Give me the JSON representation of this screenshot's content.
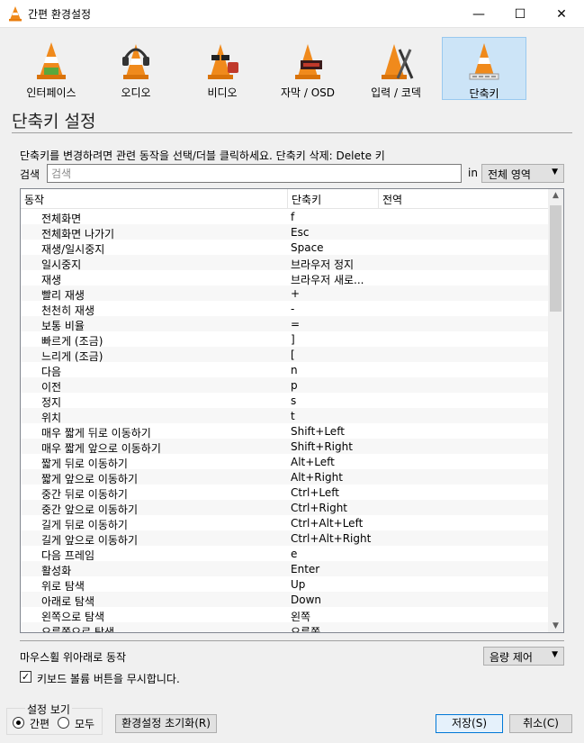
{
  "window": {
    "title": "간편 환경설정",
    "minimize": "—",
    "maximize": "☐",
    "close": "✕"
  },
  "categories": [
    {
      "label": "인터페이스",
      "icon": "interface-cone-icon"
    },
    {
      "label": "오디오",
      "icon": "audio-headphones-icon"
    },
    {
      "label": "비디오",
      "icon": "video-glasses-icon"
    },
    {
      "label": "자막 / OSD",
      "icon": "subtitle-osd-icon"
    },
    {
      "label": "입력 / 코덱",
      "icon": "input-codec-icon"
    },
    {
      "label": "단축키",
      "icon": "hotkeys-icon",
      "selected": true
    }
  ],
  "section_title": "단축키 설정",
  "hint": "단축키를 변경하려면 관련 동작을 선택/더블 클릭하세요. 단축키 삭제: Delete 키",
  "search": {
    "label": "검색",
    "placeholder": "검색",
    "value": "",
    "in_label": "in",
    "scope": "전체 영역"
  },
  "table": {
    "headers": [
      "동작",
      "단축키",
      "전역"
    ],
    "rows": [
      [
        "전체화면",
        "f"
      ],
      [
        "전체화면 나가기",
        "Esc"
      ],
      [
        "재생/일시중지",
        "Space"
      ],
      [
        "일시중지",
        "브라우저 정지"
      ],
      [
        "재생",
        "브라우저 새로..."
      ],
      [
        "빨리 재생",
        "+"
      ],
      [
        "천천히 재생",
        "-"
      ],
      [
        "보통 비율",
        "="
      ],
      [
        "빠르게 (조금)",
        "]"
      ],
      [
        "느리게 (조금)",
        "["
      ],
      [
        "다음",
        "n"
      ],
      [
        "이전",
        "p"
      ],
      [
        "정지",
        "s"
      ],
      [
        "위치",
        "t"
      ],
      [
        "매우 짧게 뒤로 이동하기",
        "Shift+Left"
      ],
      [
        "매우 짧게 앞으로 이동하기",
        "Shift+Right"
      ],
      [
        "짧게 뒤로 이동하기",
        "Alt+Left"
      ],
      [
        "짧게 앞으로 이동하기",
        "Alt+Right"
      ],
      [
        "중간 뒤로 이동하기",
        "Ctrl+Left"
      ],
      [
        "중간 앞으로 이동하기",
        "Ctrl+Right"
      ],
      [
        "길게 뒤로 이동하기",
        "Ctrl+Alt+Left"
      ],
      [
        "길게 앞으로 이동하기",
        "Ctrl+Alt+Right"
      ],
      [
        "다음 프레임",
        "e"
      ],
      [
        "활성화",
        "Enter"
      ],
      [
        "위로 탐색",
        "Up"
      ],
      [
        "아래로 탐색",
        "Down"
      ],
      [
        "왼쪽으로 탐색",
        "왼쪽"
      ],
      [
        "오른쪽으로 탐색",
        "오른쪽"
      ]
    ]
  },
  "wheel": {
    "label": "마우스휠 위아래로 동작",
    "value": "음량 제어"
  },
  "ignore_volume_keys": {
    "label": "키보드 볼륨 버튼을 무시합니다.",
    "checked": true
  },
  "view": {
    "title": "설정 보기",
    "simple": "간편",
    "all": "모두",
    "selected": "simple"
  },
  "buttons": {
    "reset": "환경설정 초기화(R)",
    "save": "저장(S)",
    "cancel": "취소(C)"
  },
  "colors": {
    "cone_orange": "#f08a1c",
    "selected_bg": "#cce4f7",
    "accent": "#0078d7"
  }
}
